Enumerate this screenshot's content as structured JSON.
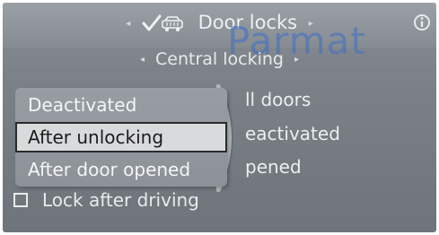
{
  "header": {
    "title": "Door locks",
    "subtitle": "Central locking",
    "nav_left": "◂",
    "nav_right": "▸"
  },
  "icons": {
    "title_icon": "check-car-icon",
    "info_icon": "info-icon"
  },
  "background_list": {
    "items": [
      "ll doors",
      "eactivated",
      "pened"
    ]
  },
  "dropdown": {
    "options": [
      "Deactivated",
      "After unlocking",
      "After door opened"
    ],
    "selected_index": 1
  },
  "lock_after_driving": {
    "label": "Lock after driving",
    "checked": false
  },
  "watermark": {
    "text": "Parmat"
  },
  "colors": {
    "background": "#7c8288",
    "highlight": "#d8dadc",
    "text": "#eceef0",
    "watermark": "#3c6ec8"
  }
}
